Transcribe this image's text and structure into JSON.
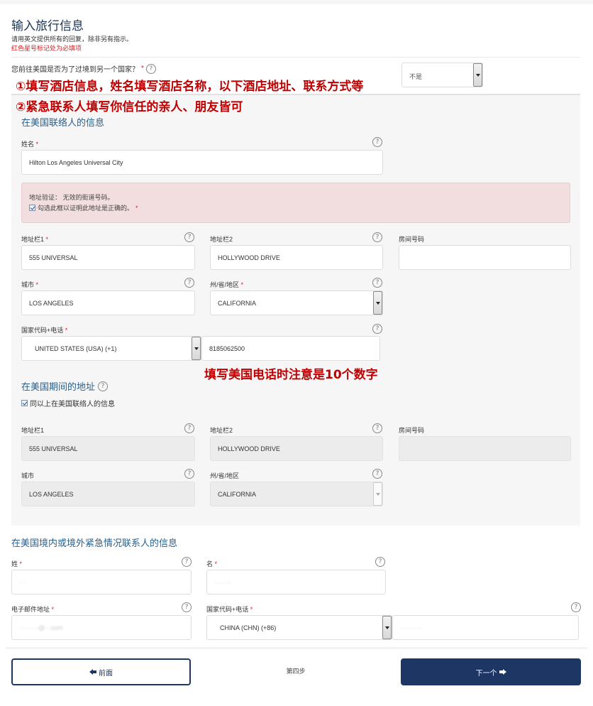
{
  "header": {
    "title": "输入旅行信息",
    "hint_english": "请用英文提供所有的回复，除非另有指示。",
    "hint_required": "红色星号标记处为必填项"
  },
  "transit_question": {
    "label": "您前往美国是否为了过境到另一个国家？",
    "required_mark": "*",
    "selected": "不是"
  },
  "annotations": {
    "note1": "①填写酒店信息，姓名填写酒店名称，以下酒店地址、联系方式等",
    "note2": "②紧急联系人填写你信任的亲人、朋友皆可",
    "note3": "填写美国电话时注意是10个数字"
  },
  "us_contact": {
    "section_title": "在美国联络人的信息",
    "name": {
      "label": "姓名",
      "required_mark": "*",
      "value": "Hilton Los Angeles Universal City"
    },
    "address_alert": {
      "message": "地址验证： 无效的街道号码。",
      "confirm_label": "勾选此框以证明此地址是正确的。",
      "required_mark": "*",
      "confirmed": true
    },
    "address1": {
      "label": "地址栏1",
      "required_mark": "*",
      "value": "555 UNIVERSAL"
    },
    "address2": {
      "label": "地址栏2",
      "value": "HOLLYWOOD DRIVE"
    },
    "room": {
      "label": "房间号码",
      "value": ""
    },
    "city": {
      "label": "城市",
      "required_mark": "*",
      "value": "LOS ANGELES"
    },
    "state": {
      "label": "州/省/地区",
      "required_mark": "*",
      "value": "CALIFORNIA"
    },
    "phone": {
      "label": "国家代码+电话",
      "required_mark": "*",
      "country": "UNITED STATES (USA) (+1)",
      "number": "8185062500"
    }
  },
  "us_address": {
    "section_title": "在美国期间的地址",
    "same_as_label": "同以上在美国联络人的信息",
    "same_as_checked": true,
    "address1": {
      "label": "地址栏1",
      "value": "555 UNIVERSAL"
    },
    "address2": {
      "label": "地址栏2",
      "value": "HOLLYWOOD DRIVE"
    },
    "room": {
      "label": "房间号码",
      "value": ""
    },
    "city": {
      "label": "城市",
      "value": "LOS ANGELES"
    },
    "state": {
      "label": "州/省/地区",
      "value": "CALIFORNIA"
    }
  },
  "emergency_contact": {
    "section_title": "在美国境内或境外紧急情况联系人的信息",
    "surname": {
      "label": "姓",
      "required_mark": "*",
      "value": "· ·"
    },
    "given_name": {
      "label": "名",
      "required_mark": "*",
      "value": "········"
    },
    "email": {
      "label": "电子邮件地址",
      "required_mark": "*",
      "value": "·········@··.com"
    },
    "phone": {
      "label": "国家代码+电话",
      "required_mark": "*",
      "country": "CHINA (CHN) (+86)",
      "number": "···········"
    }
  },
  "footer": {
    "prev_label": "前面",
    "step_label": "第四步",
    "next_label": "下一个"
  },
  "icons": {
    "help": "?"
  },
  "colors": {
    "primary_navy": "#1d3663",
    "section_title_blue": "#2a5f8a",
    "required_red": "#d2232a",
    "annotation_red": "#c00000",
    "alert_bg": "#f2dede",
    "panel_bg": "#f6f6f6"
  }
}
